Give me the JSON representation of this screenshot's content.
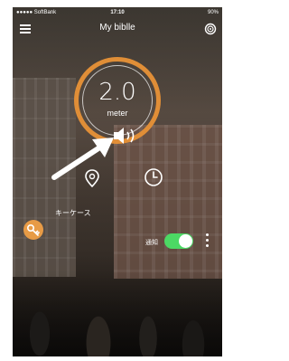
{
  "status_bar": {
    "carrier": "●●●●● SoftBank",
    "time": "17:10",
    "right": "90%"
  },
  "nav": {
    "title": "My biblle"
  },
  "distance": {
    "value": "2.0",
    "unit": "meter"
  },
  "key": {
    "label": "キーケース"
  },
  "notification": {
    "label": "通知",
    "enabled": true
  },
  "colors": {
    "accent": "#e08e37",
    "toggle_on": "#4cd964"
  },
  "icons": [
    "menu-icon",
    "target-icon",
    "speaker-icon",
    "location-pin-icon",
    "clock-icon",
    "key-icon",
    "more-icon"
  ]
}
